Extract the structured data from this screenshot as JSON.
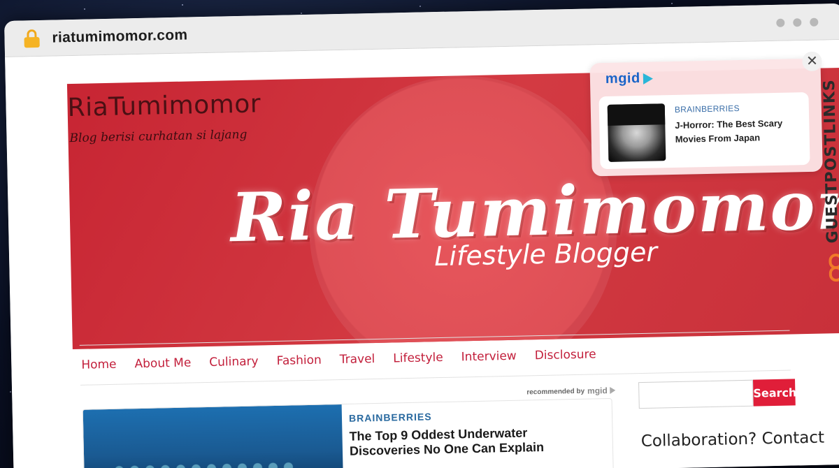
{
  "browser": {
    "url": "riatumimomor.com"
  },
  "site": {
    "title": "RiaTumimomor",
    "tagline": "Blog berisi curhatan si lajang",
    "banner_script_title": "Ria Tumimomor",
    "banner_subtitle": "Lifestyle Blogger"
  },
  "nav": {
    "items": [
      "Home",
      "About Me",
      "Culinary",
      "Fashion",
      "Travel",
      "Lifestyle",
      "Interview",
      "Disclosure"
    ]
  },
  "mgid_popup": {
    "logo": "mgid",
    "close": "✕",
    "source": "BRAINBERRIES",
    "headline": "J-Horror: The Best Scary Movies From Japan"
  },
  "recommended": {
    "label": "recommended by",
    "logo": "mgid"
  },
  "rec_card": {
    "source": "BRAINBERRIES",
    "headline": "The Top 9 Oddest Underwater Discoveries No One Can Explain"
  },
  "sidebar": {
    "search_button": "Search",
    "collab_heading": "Collaboration? Contact"
  },
  "watermark": {
    "text": "GUESTPOSTLINKS"
  },
  "colors": {
    "banner_red": "#c72533",
    "nav_red": "#c21e3a",
    "search_red": "#e01e39",
    "mgid_blue": "#1a64c8"
  }
}
